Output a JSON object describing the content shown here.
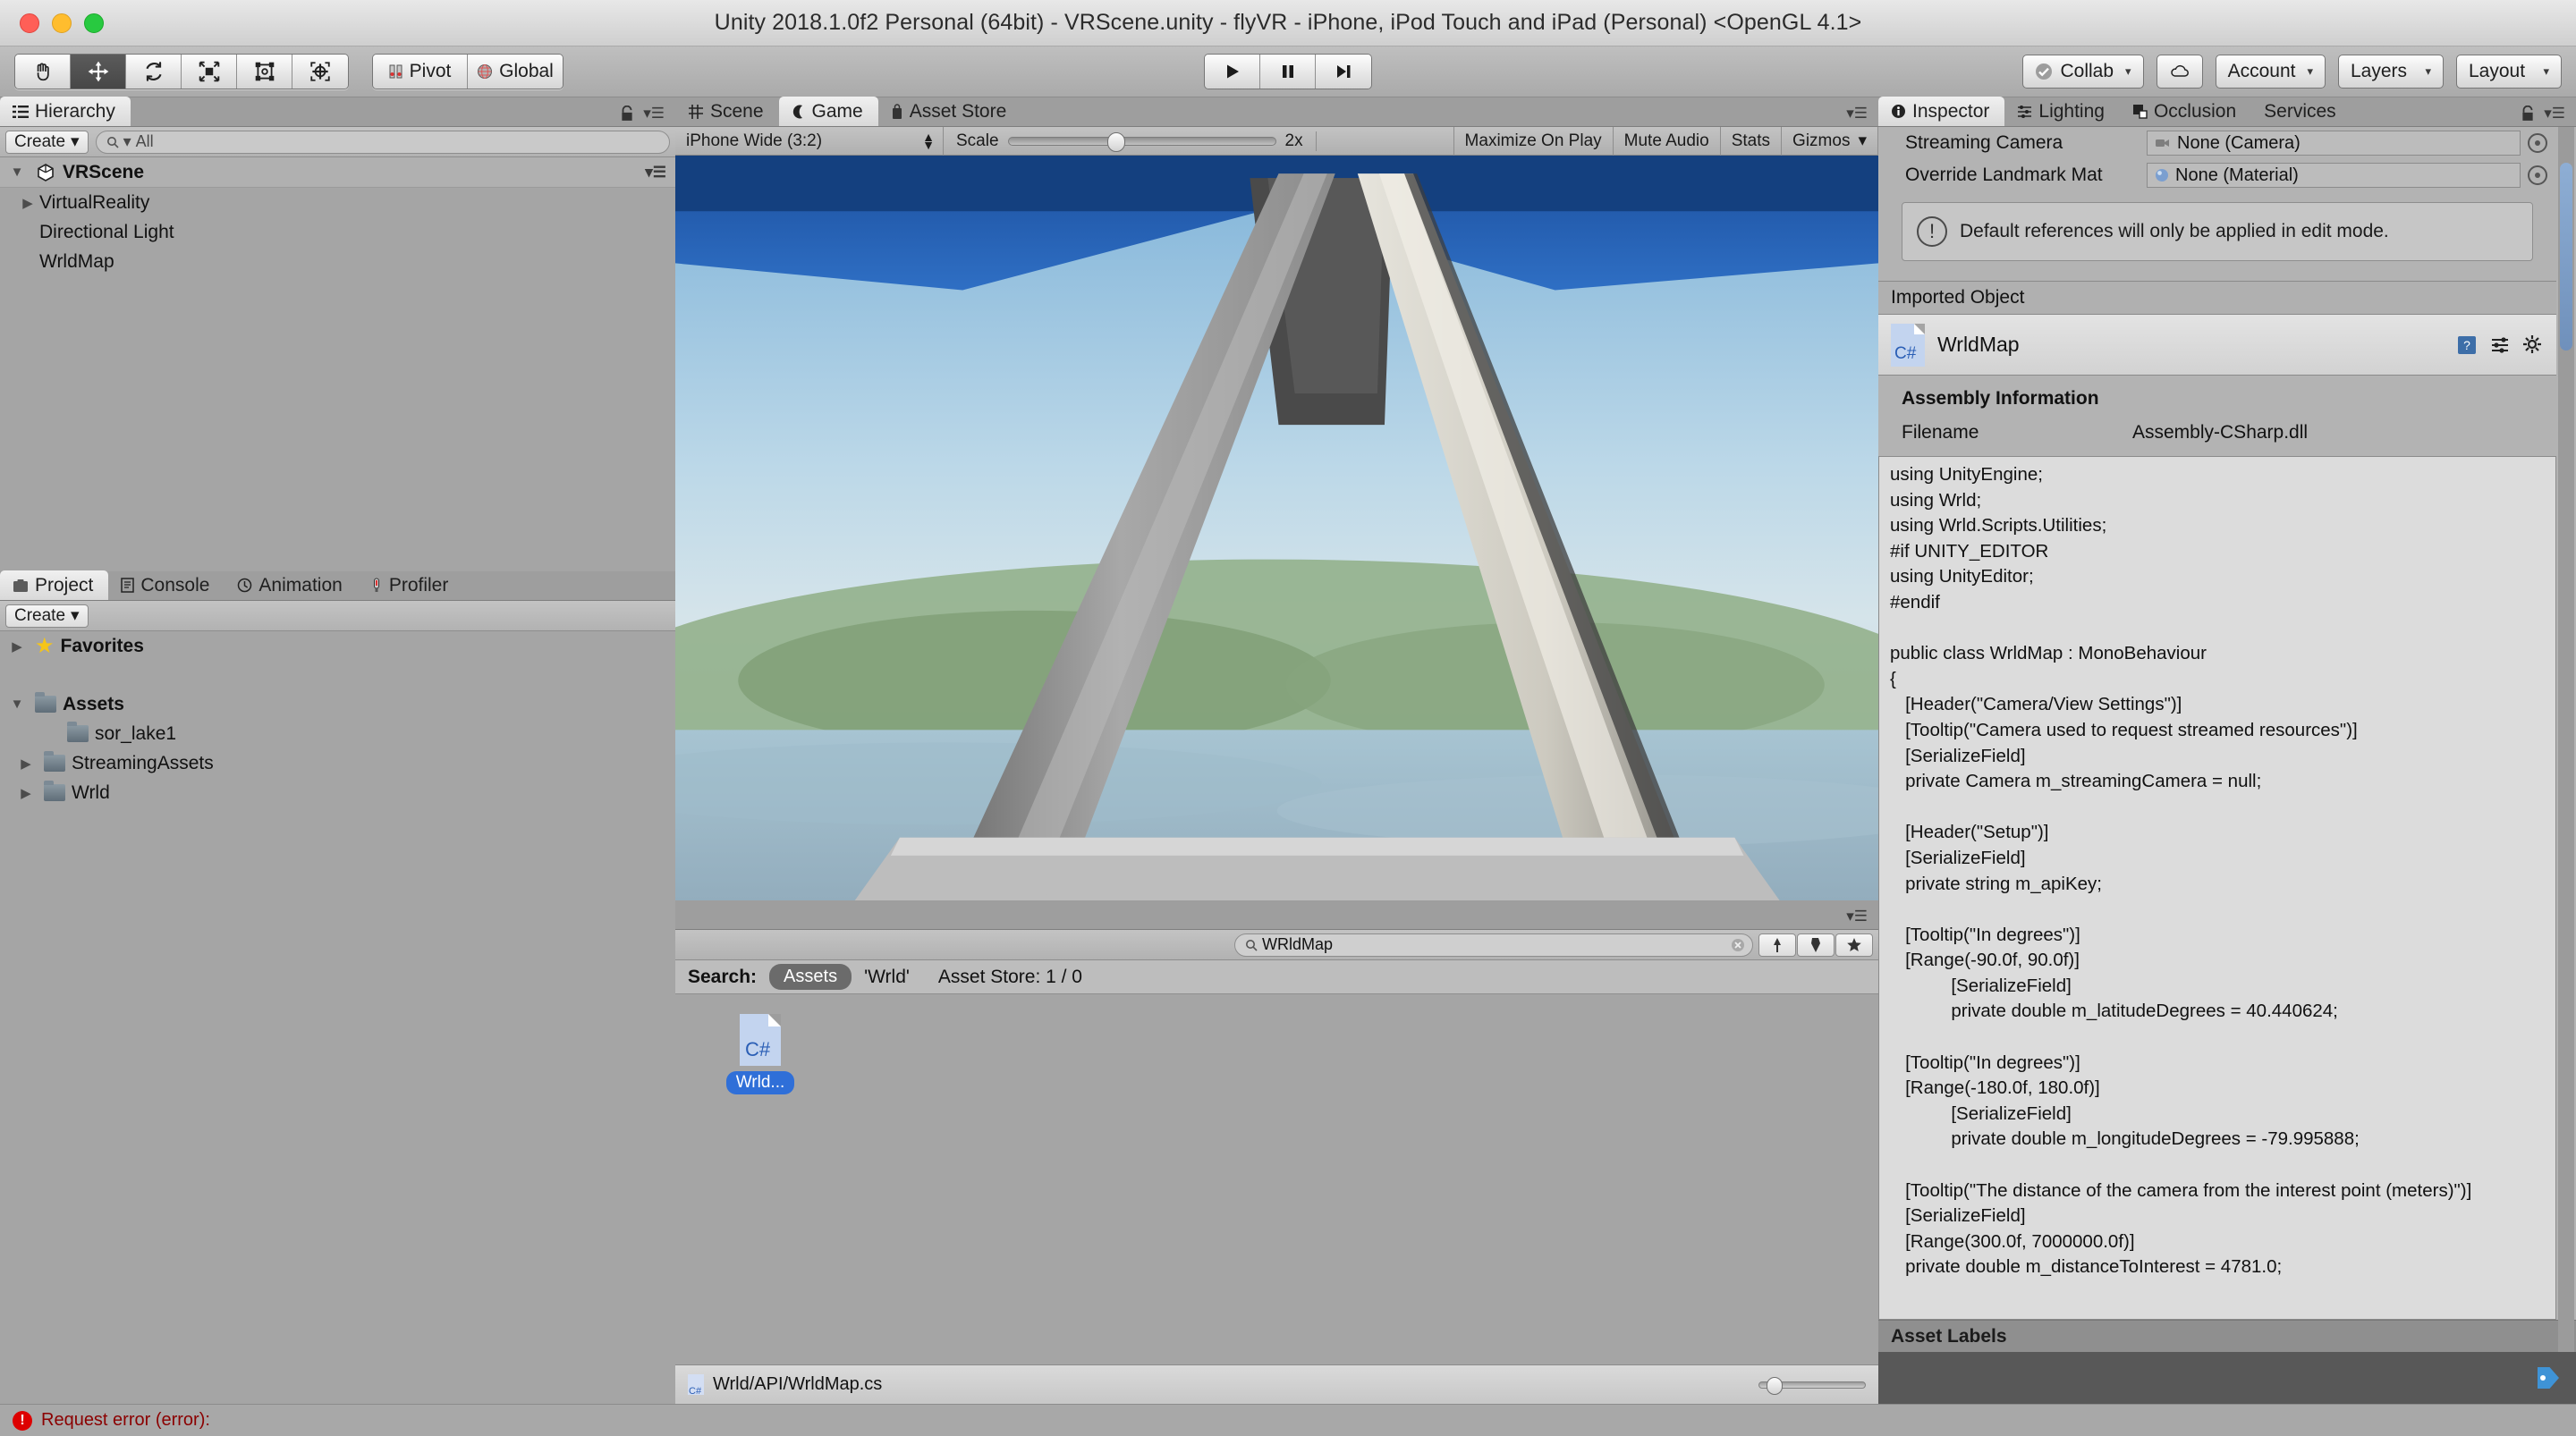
{
  "window": {
    "title": "Unity 2018.1.0f2 Personal (64bit) - VRScene.unity - flyVR - iPhone, iPod Touch and iPad (Personal) <OpenGL 4.1>"
  },
  "toolbar": {
    "tools": [
      {
        "name": "hand-tool",
        "glyph": "✋"
      },
      {
        "name": "move-tool",
        "glyph": "✥"
      },
      {
        "name": "rotate-tool",
        "glyph": "⟳"
      },
      {
        "name": "scale-tool",
        "glyph": "⤡"
      },
      {
        "name": "rect-tool",
        "glyph": "▣"
      },
      {
        "name": "transform-tool",
        "glyph": "✣"
      }
    ],
    "pivot_label": "Pivot",
    "global_label": "Global",
    "play_label": "▶",
    "pause_label": "❚❚",
    "step_label": "▶▌",
    "collab_label": "Collab",
    "cloud_label": "cloud",
    "account_label": "Account",
    "layers_label": "Layers",
    "layout_label": "Layout"
  },
  "hierarchy": {
    "tab_label": "Hierarchy",
    "create_label": "Create",
    "search_placeholder": "All",
    "scene_name": "VRScene",
    "items": [
      {
        "label": "VirtualReality",
        "expandable": true
      },
      {
        "label": "Directional Light",
        "expandable": false
      },
      {
        "label": "WrldMap",
        "expandable": false
      }
    ]
  },
  "center_tabs": [
    {
      "label": "Scene",
      "icon": "grid-icon",
      "active": false
    },
    {
      "label": "Game",
      "icon": "gamepad-icon",
      "active": true
    },
    {
      "label": "Asset Store",
      "icon": "store-icon",
      "active": false
    }
  ],
  "game_view": {
    "aspect": "iPhone Wide (3:2)",
    "scale_label": "Scale",
    "scale_value": "2x",
    "maximize_label": "Maximize On Play",
    "mute_label": "Mute Audio",
    "stats_label": "Stats",
    "gizmos_label": "Gizmos"
  },
  "inspector": {
    "tabs": [
      {
        "label": "Inspector",
        "icon": "info-icon",
        "active": true
      },
      {
        "label": "Lighting",
        "icon": "lighting-icon",
        "active": false
      },
      {
        "label": "Occlusion",
        "icon": "occlusion-icon",
        "active": false
      },
      {
        "label": "Services",
        "icon": "services-icon",
        "active": false
      }
    ],
    "fields": [
      {
        "label": "Streaming Camera",
        "value": "None (Camera)",
        "icon": "camera-icon"
      },
      {
        "label": "Override Landmark Mat",
        "value": "None (Material)",
        "icon": "material-icon"
      }
    ],
    "help_text": "Default references will only be applied in edit mode.",
    "imported_object_header": "Imported Object",
    "object_name": "WrldMap",
    "object_icon_label": "C#",
    "assembly_title": "Assembly Information",
    "assembly_filename_key": "Filename",
    "assembly_filename_value": "Assembly-CSharp.dll",
    "source_code": "using UnityEngine;\nusing Wrld;\nusing Wrld.Scripts.Utilities;\n#if UNITY_EDITOR\nusing UnityEditor;\n#endif\n\npublic class WrldMap : MonoBehaviour\n{\n   [Header(\"Camera/View Settings\")]\n   [Tooltip(\"Camera used to request streamed resources\")]\n   [SerializeField]\n   private Camera m_streamingCamera = null;\n\n   [Header(\"Setup\")]\n   [SerializeField]\n   private string m_apiKey;\n\n   [Tooltip(\"In degrees\")]\n   [Range(-90.0f, 90.0f)]\n            [SerializeField]\n            private double m_latitudeDegrees = 40.440624;\n\n   [Tooltip(\"In degrees\")]\n   [Range(-180.0f, 180.0f)]\n            [SerializeField]\n            private double m_longitudeDegrees = -79.995888;\n\n   [Tooltip(\"The distance of the camera from the interest point (meters)\")]\n   [SerializeField]\n   [Range(300.0f, 7000000.0f)]\n   private double m_distanceToInterest = 4781.0;",
    "asset_labels_header": "Asset Labels"
  },
  "project": {
    "tabs": [
      {
        "label": "Project",
        "icon": "project-icon",
        "active": true
      },
      {
        "label": "Console",
        "icon": "console-icon",
        "active": false
      },
      {
        "label": "Animation",
        "icon": "animation-icon",
        "active": false
      },
      {
        "label": "Profiler",
        "icon": "profiler-icon",
        "active": false
      }
    ],
    "create_label": "Create",
    "search_value": "WRldMap",
    "favorites_label": "Favorites",
    "tree": [
      {
        "label": "Assets",
        "depth": 0,
        "expandable": true,
        "bold": true
      },
      {
        "label": "sor_lake1",
        "depth": 1,
        "expandable": false,
        "bold": false
      },
      {
        "label": "StreamingAssets",
        "depth": 1,
        "expandable": true,
        "bold": false
      },
      {
        "label": "Wrld",
        "depth": 1,
        "expandable": true,
        "bold": false
      }
    ],
    "search_header_label": "Search:",
    "search_scope": "Assets",
    "search_term": "'Wrld'",
    "asset_store_count": "Asset Store: 1 / 0",
    "asset_item_label": "Wrld...",
    "asset_item_type": "C#",
    "footer_path": "Wrld/API/WrldMap.cs"
  },
  "statusbar": {
    "message": "Request error (error):"
  },
  "colors": {
    "accent_blue": "#2f6fd8",
    "error_red": "#8b0000",
    "panel_gray": "#a5a5a5",
    "toolbar_gray": "#b5b5b5"
  }
}
